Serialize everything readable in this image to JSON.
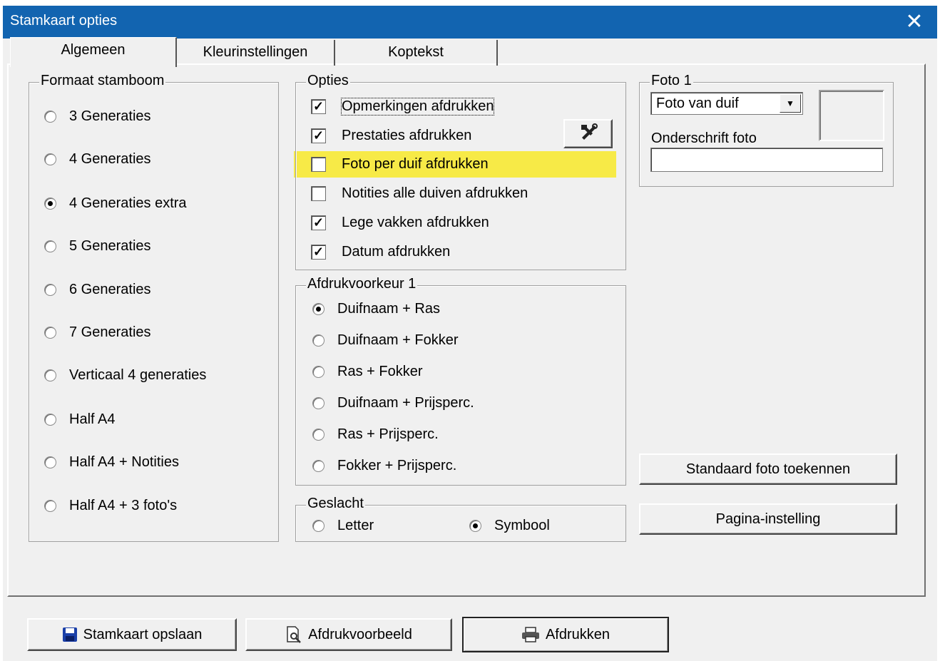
{
  "window": {
    "title": "Stamkaart opties",
    "close_glyph": "✕"
  },
  "tabs": [
    {
      "label": "Algemeen",
      "active": true
    },
    {
      "label": "Kleurinstellingen",
      "active": false
    },
    {
      "label": "Koptekst",
      "active": false
    }
  ],
  "formaat": {
    "legend": "Formaat stamboom",
    "items": [
      {
        "label": "3 Generaties",
        "selected": false
      },
      {
        "label": "4 Generaties",
        "selected": false
      },
      {
        "label": "4 Generaties extra",
        "selected": true
      },
      {
        "label": "5 Generaties",
        "selected": false
      },
      {
        "label": "6 Generaties",
        "selected": false
      },
      {
        "label": "7 Generaties",
        "selected": false
      },
      {
        "label": "Verticaal 4 generaties",
        "selected": false
      },
      {
        "label": "Half A4",
        "selected": false
      },
      {
        "label": "Half A4 + Notities",
        "selected": false
      },
      {
        "label": "Half A4 + 3 foto's",
        "selected": false
      }
    ]
  },
  "opties": {
    "legend": "Opties",
    "items": [
      {
        "label": "Opmerkingen afdrukken",
        "checked": true
      },
      {
        "label": "Prestaties afdrukken",
        "checked": true
      },
      {
        "label": "Foto per duif afdrukken",
        "checked": false
      },
      {
        "label": "Notities alle duiven afdrukken",
        "checked": false
      },
      {
        "label": "Lege vakken afdrukken",
        "checked": true
      },
      {
        "label": "Datum afdrukken",
        "checked": true
      }
    ],
    "tools_icon": "hammer-wrench-icon",
    "highlight_color": "#f7ea47"
  },
  "afdrukvoorkeur": {
    "legend": "Afdrukvoorkeur 1",
    "items": [
      {
        "label": "Duifnaam + Ras",
        "selected": true
      },
      {
        "label": "Duifnaam + Fokker",
        "selected": false
      },
      {
        "label": "Ras + Fokker",
        "selected": false
      },
      {
        "label": "Duifnaam + Prijsperc.",
        "selected": false
      },
      {
        "label": "Ras + Prijsperc.",
        "selected": false
      },
      {
        "label": "Fokker + Prijsperc.",
        "selected": false
      }
    ]
  },
  "geslacht": {
    "legend": "Geslacht",
    "items": [
      {
        "label": "Letter",
        "selected": false
      },
      {
        "label": "Symbool",
        "selected": true
      }
    ]
  },
  "foto": {
    "legend": "Foto 1",
    "select_value": "Foto van duif",
    "caption_label": "Onderschrift foto",
    "caption_value": ""
  },
  "buttons": {
    "standaard_foto": "Standaard foto toekennen",
    "pagina_instelling": "Pagina-instelling",
    "opslaan": "Stamkaart opslaan",
    "voorbeeld": "Afdrukvoorbeeld",
    "afdrukken": "Afdrukken"
  },
  "colors": {
    "titlebar": "#1264b0",
    "dialog_bg": "#f0f0f0"
  }
}
